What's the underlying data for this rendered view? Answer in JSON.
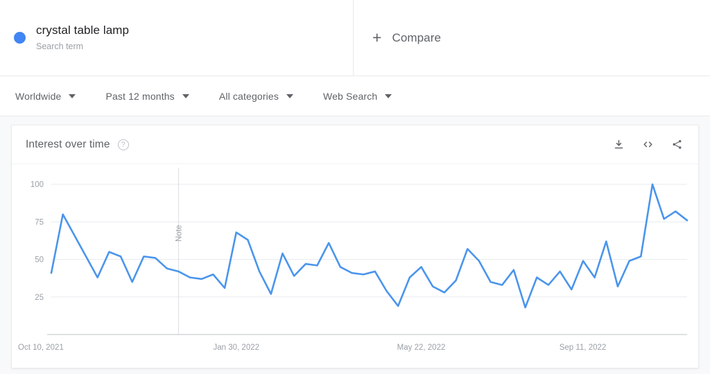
{
  "header": {
    "term": {
      "title": "crystal table lamp",
      "subtitle": "Search term",
      "dot_color": "#4285f4"
    },
    "compare": {
      "label": "Compare",
      "icon": "plus-icon"
    }
  },
  "filters": [
    {
      "label": "Worldwide",
      "name": "location"
    },
    {
      "label": "Past 12 months",
      "name": "time-range"
    },
    {
      "label": "All categories",
      "name": "category"
    },
    {
      "label": "Web Search",
      "name": "search-type"
    }
  ],
  "card": {
    "title": "Interest over time",
    "help_icon": "?",
    "actions": [
      {
        "name": "download-icon",
        "label": "Download"
      },
      {
        "name": "embed-code-icon",
        "label": "Embed"
      },
      {
        "name": "share-icon",
        "label": "Share"
      }
    ]
  },
  "chart_data": {
    "type": "line",
    "title": "Interest over time",
    "xlabel": "",
    "ylabel": "",
    "ylim": [
      0,
      107
    ],
    "yticks": [
      25,
      50,
      75,
      100
    ],
    "grid": true,
    "legend_position": "top",
    "line_color": "#4a95ec",
    "xtick_labels": [
      "Oct 10, 2021",
      "Jan 30, 2022",
      "May 22, 2022",
      "Sep 11, 2022"
    ],
    "xtick_indices": [
      0,
      16,
      32,
      48
    ],
    "annotations": [
      {
        "label": "Note",
        "index": 11
      }
    ],
    "series": [
      {
        "name": "crystal table lamp",
        "values": [
          41,
          80,
          66,
          52,
          38,
          55,
          52,
          35,
          52,
          51,
          44,
          42,
          38,
          37,
          40,
          31,
          68,
          63,
          42,
          27,
          54,
          39,
          47,
          46,
          61,
          45,
          41,
          40,
          42,
          29,
          19,
          38,
          45,
          32,
          28,
          36,
          57,
          49,
          35,
          33,
          43,
          18,
          38,
          33,
          42,
          30,
          49,
          38,
          62,
          32,
          49,
          52,
          100,
          77,
          82,
          76
        ]
      }
    ]
  }
}
